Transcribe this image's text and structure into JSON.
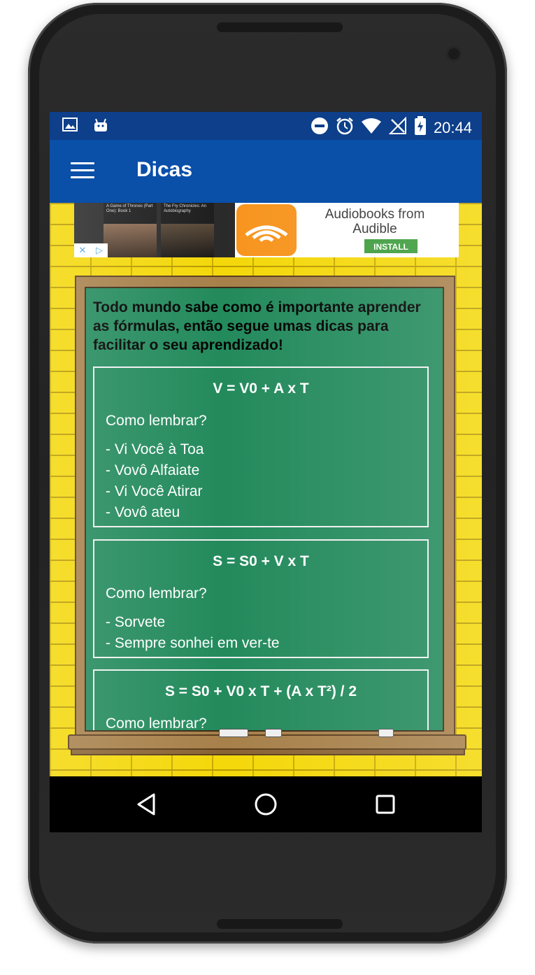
{
  "status_bar": {
    "time": "20:44",
    "left_icons": [
      "image-icon",
      "android-icon"
    ],
    "right_icons": [
      "dnd-icon",
      "alarm-icon",
      "wifi-icon",
      "no-signal-icon",
      "battery-charging-icon"
    ]
  },
  "app_bar": {
    "title": "Dicas",
    "menu_icon": "hamburger-menu-icon"
  },
  "ad": {
    "book1_title": "A Game of Thrones (Part One): Book 1",
    "book2_title": "The Fry Chronicles: An Autobiography",
    "text": "Audiobooks from Audible",
    "install_label": "INSTALL"
  },
  "intro": "Todo mundo sabe como é importante aprender as fórmulas, então segue umas dicas para facilitar o seu aprendizado!",
  "cards": [
    {
      "formula": "V = V0 + A x T",
      "question": "Como lembrar?",
      "tips": [
        "- Vi Você à Toa",
        "- Vovô Alfaiate",
        "- Vi Você Atirar",
        "- Vovô ateu"
      ]
    },
    {
      "formula": "S = S0 + V x T",
      "question": "Como lembrar?",
      "tips": [
        "- Sorvete",
        "- Sempre sonhei em ver-te"
      ]
    },
    {
      "formula": "S = S0 + V0 x T + (A x T²) / 2",
      "question": "Como lembrar?",
      "tips": []
    }
  ],
  "nav": {
    "back_icon": "back-triangle-icon",
    "home_icon": "home-circle-icon",
    "recents_icon": "recents-square-icon"
  },
  "colors": {
    "status_bar": "#0d3f8a",
    "app_bar": "#0a4fa8",
    "wall": "#f4d80a",
    "chalkboard": "#238a5c",
    "frame": "#a7804a",
    "install": "#3c9c3c",
    "audible": "#f7941d"
  }
}
